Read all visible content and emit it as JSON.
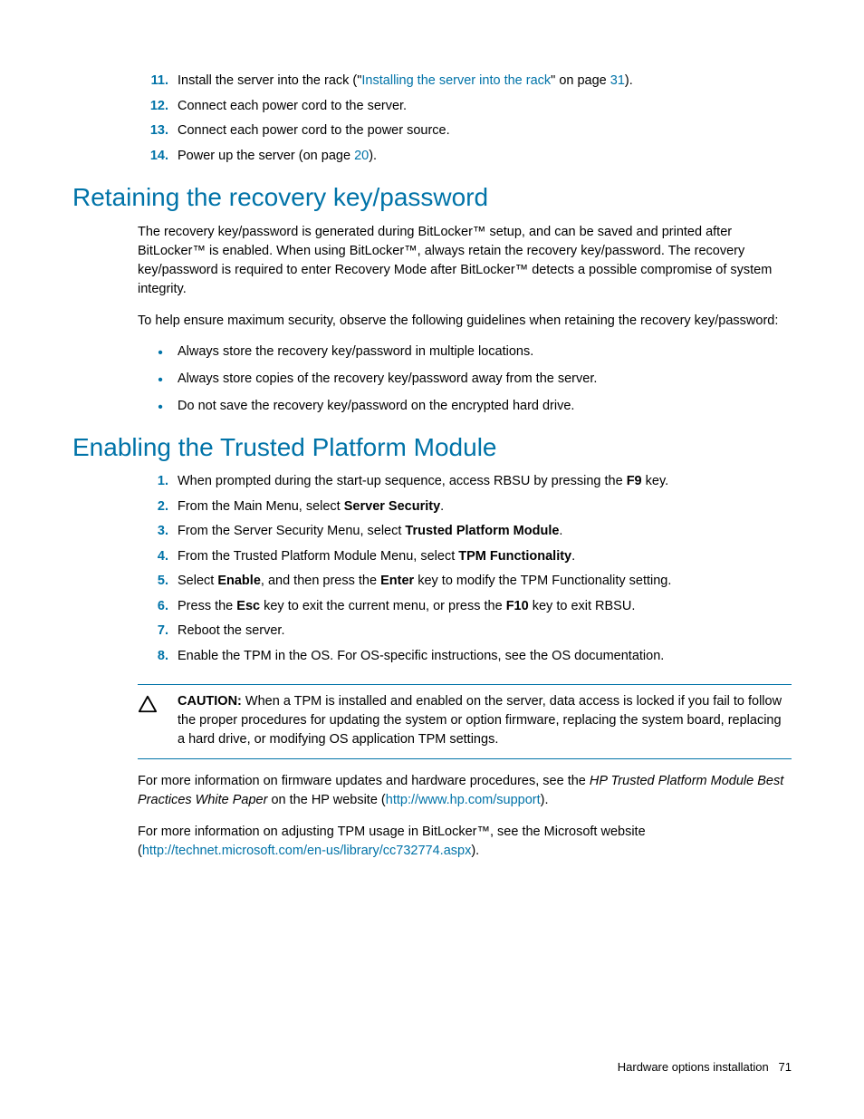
{
  "top_steps": {
    "s11": {
      "num": "11.",
      "pre": "Install the server into the rack (\"",
      "link": "Installing the server into the rack",
      "mid": "\" on page ",
      "page": "31",
      "post": ")."
    },
    "s12": {
      "num": "12.",
      "text": "Connect each power cord to the server."
    },
    "s13": {
      "num": "13.",
      "text": "Connect each power cord to the power source."
    },
    "s14": {
      "num": "14.",
      "pre": "Power up the server (on page ",
      "page": "20",
      "post": ")."
    }
  },
  "heading1": "Retaining the recovery key/password",
  "para1": "The recovery key/password is generated during BitLocker™ setup, and can be saved and printed after BitLocker™ is enabled. When using BitLocker™, always retain the recovery key/password. The recovery key/password is required to enter Recovery Mode after BitLocker™ detects a possible compromise of system integrity.",
  "para2": "To help ensure maximum security, observe the following guidelines when retaining the recovery key/password:",
  "bullets1": {
    "b1": "Always store the recovery key/password in multiple locations.",
    "b2": "Always store copies of the recovery key/password away from the server.",
    "b3": "Do not save the recovery key/password on the encrypted hard drive."
  },
  "heading2": "Enabling the Trusted Platform Module",
  "steps2": {
    "s1": {
      "num": "1.",
      "pre": "When prompted during the start-up sequence, access RBSU by pressing the ",
      "b1": "F9",
      "post": " key."
    },
    "s2": {
      "num": "2.",
      "pre": "From the Main Menu, select ",
      "b1": "Server Security",
      "post": "."
    },
    "s3": {
      "num": "3.",
      "pre": "From the Server Security Menu, select ",
      "b1": "Trusted Platform Module",
      "post": "."
    },
    "s4": {
      "num": "4.",
      "pre": "From the Trusted Platform Module Menu, select ",
      "b1": "TPM Functionality",
      "post": "."
    },
    "s5": {
      "num": "5.",
      "pre": "Select ",
      "b1": "Enable",
      "mid": ", and then press the ",
      "b2": "Enter",
      "post": " key to modify the TPM Functionality setting."
    },
    "s6": {
      "num": "6.",
      "pre": "Press the ",
      "b1": "Esc",
      "mid": " key to exit the current menu, or press the ",
      "b2": "F10",
      "post": " key to exit RBSU."
    },
    "s7": {
      "num": "7.",
      "text": "Reboot the server."
    },
    "s8": {
      "num": "8.",
      "text": "Enable the TPM in the OS. For OS-specific instructions, see the OS documentation."
    }
  },
  "caution": {
    "label": "CAUTION:",
    "text": "   When a TPM is installed and enabled on the server, data access is locked if you fail to follow the proper procedures for updating the system or option firmware, replacing the system board, replacing a hard drive, or modifying OS application TPM settings."
  },
  "para3": {
    "pre": "For more information on firmware updates and hardware procedures, see the ",
    "i1": "HP Trusted Platform Module Best Practices White Paper",
    "mid": " on the HP website (",
    "link": "http://www.hp.com/support",
    "post": ")."
  },
  "para4": {
    "pre": "For more information on adjusting TPM usage in BitLocker™, see the Microsoft website (",
    "link": "http://technet.microsoft.com/en-us/library/cc732774.aspx",
    "post": ")."
  },
  "footer": {
    "section": "Hardware options installation",
    "page": "71"
  }
}
